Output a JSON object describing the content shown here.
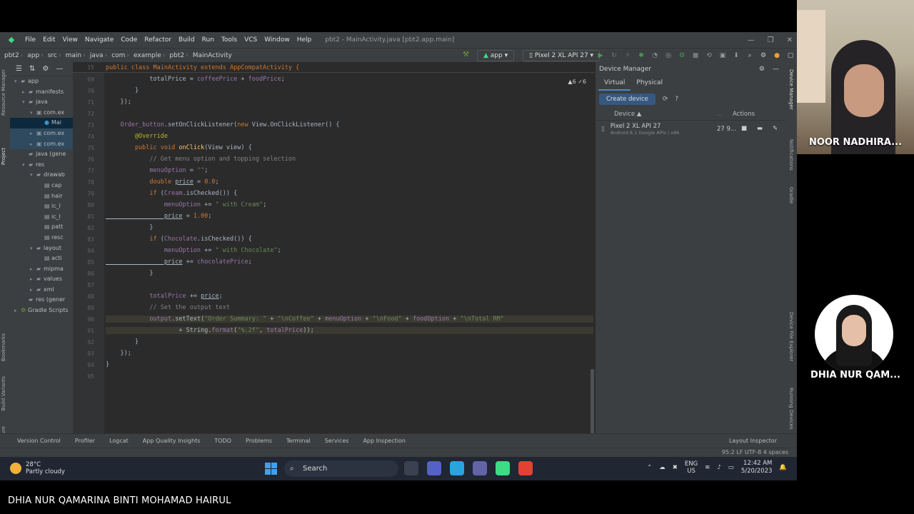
{
  "ide": {
    "menu": [
      "File",
      "Edit",
      "View",
      "Navigate",
      "Code",
      "Refactor",
      "Build",
      "Run",
      "Tools",
      "VCS",
      "Window",
      "Help"
    ],
    "window_title": "pbt2 - MainActivity.java [pbt2.app.main]",
    "breadcrumb": [
      "pbt2",
      "app",
      "src",
      "main",
      "java",
      "com",
      "example",
      "pbt2",
      "MainActivity"
    ],
    "run_config": "app",
    "device_config": "Pixel 2 XL API 27"
  },
  "project_tree": [
    {
      "label": "app",
      "level": 0,
      "arrow": "▾",
      "icon": "folder"
    },
    {
      "label": "manifests",
      "level": 1,
      "arrow": "▸",
      "icon": "folder"
    },
    {
      "label": "java",
      "level": 1,
      "arrow": "▾",
      "icon": "folder"
    },
    {
      "label": "com.ex",
      "level": 2,
      "arrow": "▾",
      "icon": "package"
    },
    {
      "label": "Mai",
      "level": 3,
      "arrow": "",
      "icon": "class",
      "selected": true
    },
    {
      "label": "com.ex",
      "level": 2,
      "arrow": "▸",
      "icon": "package",
      "sel2": true
    },
    {
      "label": "com.ex",
      "level": 2,
      "arrow": "▸",
      "icon": "package",
      "sel2": true
    },
    {
      "label": "java (gene",
      "level": 1,
      "arrow": "",
      "icon": "folder"
    },
    {
      "label": "res",
      "level": 1,
      "arrow": "▾",
      "icon": "folder"
    },
    {
      "label": "drawab",
      "level": 2,
      "arrow": "▾",
      "icon": "folder"
    },
    {
      "label": "cap",
      "level": 3,
      "arrow": "",
      "icon": "file"
    },
    {
      "label": "hair",
      "level": 3,
      "arrow": "",
      "icon": "file"
    },
    {
      "label": "ic_l",
      "level": 3,
      "arrow": "",
      "icon": "file"
    },
    {
      "label": "ic_l",
      "level": 3,
      "arrow": "",
      "icon": "file"
    },
    {
      "label": "patt",
      "level": 3,
      "arrow": "",
      "icon": "file"
    },
    {
      "label": "resc",
      "level": 3,
      "arrow": "",
      "icon": "file"
    },
    {
      "label": "layout",
      "level": 2,
      "arrow": "▾",
      "icon": "folder"
    },
    {
      "label": "acti",
      "level": 3,
      "arrow": "",
      "icon": "file"
    },
    {
      "label": "mipma",
      "level": 2,
      "arrow": "▸",
      "icon": "folder"
    },
    {
      "label": "values",
      "level": 2,
      "arrow": "▸",
      "icon": "folder"
    },
    {
      "label": "xml",
      "level": 2,
      "arrow": "▸",
      "icon": "folder"
    },
    {
      "label": "res (gener",
      "level": 1,
      "arrow": "",
      "icon": "folder"
    },
    {
      "label": "Gradle Scripts",
      "level": 0,
      "arrow": "▸",
      "icon": "gradle"
    }
  ],
  "editor": {
    "sticky_line_number": "15",
    "sticky": "public class MainActivity extends AppCompatActivity {",
    "inspections": "▲6  ✓6",
    "lines": [
      {
        "n": "69",
        "segs": [
          [
            "",
            "            totalPrice = "
          ],
          [
            "fld",
            "coffeePrice"
          ],
          [
            "",
            " + "
          ],
          [
            "fld",
            "foodPrice"
          ],
          [
            "",
            ";"
          ]
        ]
      },
      {
        "n": "70",
        "segs": [
          [
            "",
            "        }"
          ]
        ]
      },
      {
        "n": "71",
        "segs": [
          [
            "",
            "    });"
          ]
        ]
      },
      {
        "n": "72",
        "segs": [
          [
            "",
            ""
          ]
        ]
      },
      {
        "n": "73",
        "segs": [
          [
            "fld",
            "    Order_button"
          ],
          [
            "",
            ".setOnClickListener("
          ],
          [
            "kw",
            "new "
          ],
          [
            "",
            "View.OnClickListener() {"
          ]
        ]
      },
      {
        "n": "74",
        "segs": [
          [
            "ann",
            "        @Override"
          ]
        ]
      },
      {
        "n": "75",
        "segs": [
          [
            "kw",
            "        public void "
          ],
          [
            "fn",
            "onClick"
          ],
          [
            "",
            "(View view) {"
          ]
        ]
      },
      {
        "n": "76",
        "segs": [
          [
            "cm",
            "            // Get menu option and topping selection"
          ]
        ]
      },
      {
        "n": "77",
        "segs": [
          [
            "fld",
            "            menuOption"
          ],
          [
            "",
            " = "
          ],
          [
            "str",
            "\"\""
          ],
          [
            "",
            ";"
          ]
        ]
      },
      {
        "n": "78",
        "segs": [
          [
            "kw",
            "            double "
          ],
          [
            "ul",
            "price"
          ],
          [
            "",
            " = "
          ],
          [
            "kw",
            "0.0"
          ],
          [
            "",
            ";"
          ]
        ]
      },
      {
        "n": "79",
        "segs": [
          [
            "kw",
            "            if "
          ],
          [
            "",
            "("
          ],
          [
            "fld",
            "Cream"
          ],
          [
            "",
            ".isChecked()) {"
          ]
        ]
      },
      {
        "n": "80",
        "segs": [
          [
            "fld",
            "                menuOption"
          ],
          [
            "",
            " += "
          ],
          [
            "str",
            "\" with Cream\""
          ],
          [
            "",
            ";"
          ]
        ]
      },
      {
        "n": "81",
        "segs": [
          [
            "ul",
            "                price"
          ],
          [
            "",
            " = "
          ],
          [
            "kw",
            "1.00"
          ],
          [
            "",
            ";"
          ]
        ]
      },
      {
        "n": "82",
        "segs": [
          [
            "",
            "            }"
          ]
        ]
      },
      {
        "n": "83",
        "segs": [
          [
            "kw",
            "            if "
          ],
          [
            "",
            "("
          ],
          [
            "fld",
            "Chocolate"
          ],
          [
            "",
            ".isChecked()) {"
          ]
        ]
      },
      {
        "n": "84",
        "segs": [
          [
            "fld",
            "                menuOption"
          ],
          [
            "",
            " += "
          ],
          [
            "str",
            "\" with Chocolate\""
          ],
          [
            "",
            ";"
          ]
        ]
      },
      {
        "n": "85",
        "segs": [
          [
            "ul",
            "                price"
          ],
          [
            "",
            " += "
          ],
          [
            "fld",
            "chocolatePrice"
          ],
          [
            "",
            ";"
          ]
        ]
      },
      {
        "n": "86",
        "segs": [
          [
            "",
            "            }"
          ]
        ]
      },
      {
        "n": "87",
        "segs": [
          [
            "",
            ""
          ]
        ]
      },
      {
        "n": "88",
        "segs": [
          [
            "fld",
            "            totalPrice"
          ],
          [
            "",
            " += "
          ],
          [
            "ul",
            "price"
          ],
          [
            "",
            ";"
          ]
        ]
      },
      {
        "n": "89",
        "segs": [
          [
            "cm",
            "            // Set the output text"
          ]
        ]
      },
      {
        "n": "90",
        "segs": [
          [
            "fld",
            "            output"
          ],
          [
            "",
            ".setText("
          ],
          [
            "str",
            "\"Order Summary: \""
          ],
          [
            "",
            " + "
          ],
          [
            "str",
            "\"\\nCoffee\""
          ],
          [
            "",
            " + "
          ],
          [
            "fld",
            "menuOption"
          ],
          [
            "",
            " + "
          ],
          [
            "str",
            "\"\\nFood\""
          ],
          [
            "",
            " + "
          ],
          [
            "fld",
            "foodOption"
          ],
          [
            "",
            " + "
          ],
          [
            "str",
            "\"\\nTotal RM\""
          ]
        ],
        "hl": true
      },
      {
        "n": "91",
        "segs": [
          [
            "",
            "                    + String."
          ],
          [
            "fld",
            "format"
          ],
          [
            "",
            "("
          ],
          [
            "str",
            "\"%.2f\""
          ],
          [
            "",
            ", "
          ],
          [
            "fld",
            "totalPrice"
          ],
          [
            "",
            "));"
          ]
        ],
        "hl": true
      },
      {
        "n": "92",
        "segs": [
          [
            "",
            "        }"
          ]
        ]
      },
      {
        "n": "93",
        "segs": [
          [
            "",
            "    });"
          ]
        ]
      },
      {
        "n": "94",
        "segs": [
          [
            "",
            "}"
          ]
        ]
      },
      {
        "n": "95",
        "segs": [
          [
            "",
            ""
          ]
        ]
      }
    ]
  },
  "device_manager": {
    "title": "Device Manager",
    "tabs": [
      "Virtual",
      "Physical"
    ],
    "create_button": "Create device",
    "columns": {
      "device": "Device ▲",
      "actions": "Actions"
    },
    "device_name": "Pixel 2 XL API 27",
    "device_sub": "Android 8.1 Google APIs | x86",
    "device_size": "27 9..."
  },
  "side_labels": {
    "left": [
      "Resource Manager",
      "Project",
      "Bookmarks",
      "Build Variants",
      "Structure"
    ],
    "right": [
      "Device Manager",
      "Notifications",
      "Gradle",
      "Device File Explorer",
      "Running Devices"
    ]
  },
  "bottom_tools": [
    "Version Control",
    "Profiler",
    "Logcat",
    "App Quality Insights",
    "TODO",
    "Problems",
    "Terminal",
    "Services",
    "App Inspection"
  ],
  "layout_inspector": "Layout Inspector",
  "status": "95:2   LF   UTF-8   4 spaces",
  "taskbar": {
    "temp": "28°C",
    "weather": "Partly cloudy",
    "search": "Search",
    "lang": "ENG",
    "region": "US",
    "time": "12:42 AM",
    "date": "5/20/2023"
  },
  "participants": [
    "NOOR NADHIRA...",
    "DHIA NUR QAM..."
  ],
  "caption": "DHIA NUR QAMARINA BINTI MOHAMAD HAIRUL"
}
